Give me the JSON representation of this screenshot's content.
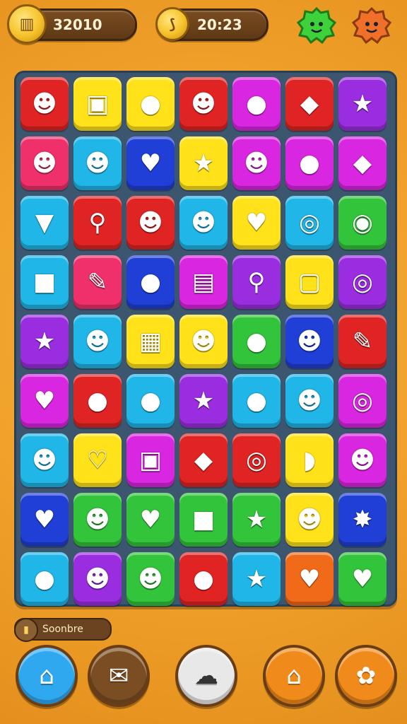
{
  "header": {
    "coins_value": "32010",
    "timer_value": "20:23",
    "coin_icon": "coin-icon",
    "timer_icon": "timer-icon",
    "gem_green_icon": "green-blob-icon",
    "gem_orange_icon": "orange-blob-icon"
  },
  "status": {
    "text": "Soonbre",
    "icon": "coin-small-icon"
  },
  "board": {
    "rows": [
      [
        {
          "c": "#e02424",
          "i": "☻"
        },
        {
          "c": "#ffe21a",
          "i": "▣"
        },
        {
          "c": "#ffe21a",
          "i": "●"
        },
        {
          "c": "#e02424",
          "i": "☻"
        },
        {
          "c": "#d926e0",
          "i": "●"
        },
        {
          "c": "#e02424",
          "i": "◆"
        },
        {
          "c": "#9b2de0",
          "i": "★"
        }
      ],
      [
        {
          "c": "#f0306a",
          "i": "☻"
        },
        {
          "c": "#20b6e8",
          "i": "☻"
        },
        {
          "c": "#1f3fd6",
          "i": "♥"
        },
        {
          "c": "#ffe21a",
          "i": "★"
        },
        {
          "c": "#d926e0",
          "i": "☻"
        },
        {
          "c": "#d926e0",
          "i": "●"
        },
        {
          "c": "#d926e0",
          "i": "◆"
        }
      ],
      [
        {
          "c": "#20b6e8",
          "i": "▼"
        },
        {
          "c": "#e02424",
          "i": "⚲"
        },
        {
          "c": "#e02424",
          "i": "☻"
        },
        {
          "c": "#20b6e8",
          "i": "☻"
        },
        {
          "c": "#ffe21a",
          "i": "♥"
        },
        {
          "c": "#20b6e8",
          "i": "◎"
        },
        {
          "c": "#32c43a",
          "i": "◉"
        }
      ],
      [
        {
          "c": "#20b6e8",
          "i": "■"
        },
        {
          "c": "#f0306a",
          "i": "✎"
        },
        {
          "c": "#1f3fd6",
          "i": "●"
        },
        {
          "c": "#d926e0",
          "i": "▤"
        },
        {
          "c": "#9b2de0",
          "i": "⚲"
        },
        {
          "c": "#ffe21a",
          "i": "▢"
        },
        {
          "c": "#9b2de0",
          "i": "◎"
        }
      ],
      [
        {
          "c": "#9b2de0",
          "i": "★"
        },
        {
          "c": "#20b6e8",
          "i": "☻"
        },
        {
          "c": "#ffe21a",
          "i": "▦"
        },
        {
          "c": "#ffe21a",
          "i": "☻"
        },
        {
          "c": "#32c43a",
          "i": "●"
        },
        {
          "c": "#1f3fd6",
          "i": "☻"
        },
        {
          "c": "#e02424",
          "i": "✎"
        }
      ],
      [
        {
          "c": "#d926e0",
          "i": "♥"
        },
        {
          "c": "#e02424",
          "i": "●"
        },
        {
          "c": "#20b6e8",
          "i": "●"
        },
        {
          "c": "#9b2de0",
          "i": "★"
        },
        {
          "c": "#20b6e8",
          "i": "●"
        },
        {
          "c": "#20b6e8",
          "i": "☻"
        },
        {
          "c": "#d926e0",
          "i": "◎"
        }
      ],
      [
        {
          "c": "#20b6e8",
          "i": "☻"
        },
        {
          "c": "#ffe21a",
          "i": "♡"
        },
        {
          "c": "#d926e0",
          "i": "▣"
        },
        {
          "c": "#e02424",
          "i": "◆"
        },
        {
          "c": "#e02424",
          "i": "◎"
        },
        {
          "c": "#ffe21a",
          "i": "◗"
        },
        {
          "c": "#d926e0",
          "i": "☻"
        }
      ],
      [
        {
          "c": "#1f3fd6",
          "i": "♥"
        },
        {
          "c": "#32c43a",
          "i": "☻"
        },
        {
          "c": "#32c43a",
          "i": "♥"
        },
        {
          "c": "#32c43a",
          "i": "■"
        },
        {
          "c": "#32c43a",
          "i": "★"
        },
        {
          "c": "#ffe21a",
          "i": "☻"
        },
        {
          "c": "#1f3fd6",
          "i": "✸"
        }
      ],
      [
        {
          "c": "#20b6e8",
          "i": "●"
        },
        {
          "c": "#9b2de0",
          "i": "☻"
        },
        {
          "c": "#32c43a",
          "i": "☻"
        },
        {
          "c": "#e02424",
          "i": "●"
        },
        {
          "c": "#20b6e8",
          "i": "★"
        },
        {
          "c": "#f06a1a",
          "i": "♥"
        },
        {
          "c": "#32c43a",
          "i": "♥"
        }
      ]
    ]
  },
  "nav": [
    {
      "name": "home-icon",
      "glyph": "⌂",
      "color": "#2fa8f0"
    },
    {
      "name": "mail-icon",
      "glyph": "✉",
      "color": "#7a4d22"
    },
    {
      "name": "chat-icon",
      "glyph": "☁",
      "color": "#e8e8e8"
    },
    {
      "name": "house-icon",
      "glyph": "⌂",
      "color": "#f08a1a"
    },
    {
      "name": "flower-icon",
      "glyph": "✿",
      "color": "#f08a1a"
    }
  ]
}
